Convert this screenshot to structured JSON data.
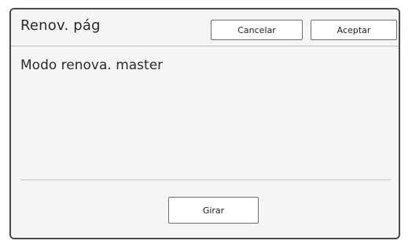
{
  "dialog": {
    "title": "Renov. pág",
    "cancel_label": "Cancelar",
    "accept_label": "Aceptar",
    "message": "Modo renova. master",
    "rotate_label": "Girar"
  }
}
